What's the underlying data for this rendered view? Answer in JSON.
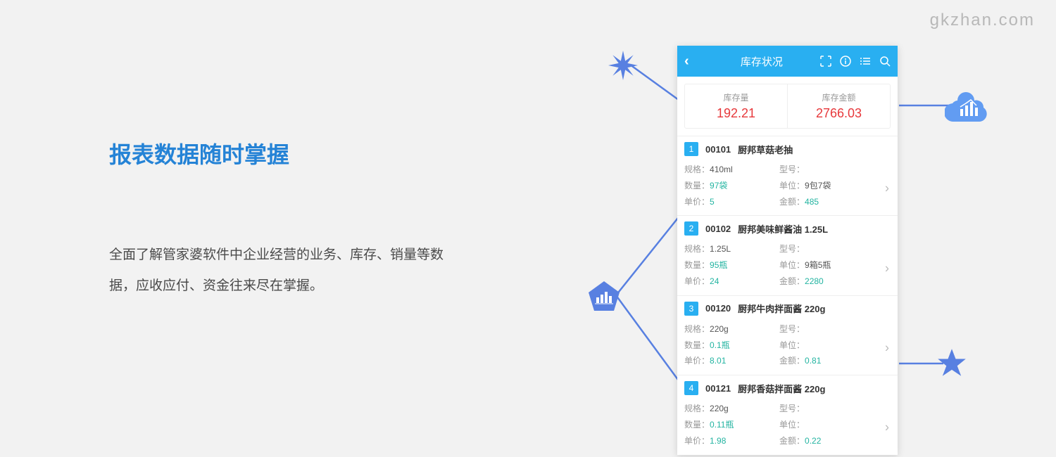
{
  "watermark": "gkzhan.com",
  "heading": "报表数据随时掌握",
  "description": "全面了解管家婆软件中企业经营的业务、库存、销量等数据，应收应付、资金往来尽在掌握。",
  "phone": {
    "title": "库存状况",
    "summary": {
      "qty_label": "库存量",
      "qty_value": "192.21",
      "amount_label": "库存金额",
      "amount_value": "2766.03"
    },
    "items": [
      {
        "num": "1",
        "code": "00101",
        "name": "厨邦草菇老抽",
        "spec_label": "规格：",
        "spec": "410ml",
        "model_label": "型号：",
        "model": "",
        "qty_label": "数量：",
        "qty": "97袋",
        "unit_label": "单位：",
        "unit": "9包7袋",
        "price_label": "单价：",
        "price": "5",
        "amount_label": "金额：",
        "amount": "485"
      },
      {
        "num": "2",
        "code": "00102",
        "name": "厨邦美味鲜酱油 1.25L",
        "spec_label": "规格：",
        "spec": "1.25L",
        "model_label": "型号：",
        "model": "",
        "qty_label": "数量：",
        "qty": "95瓶",
        "unit_label": "单位：",
        "unit": "9箱5瓶",
        "price_label": "单价：",
        "price": "24",
        "amount_label": "金额：",
        "amount": "2280"
      },
      {
        "num": "3",
        "code": "00120",
        "name": "厨邦牛肉拌面酱 220g",
        "spec_label": "规格：",
        "spec": "220g",
        "model_label": "型号：",
        "model": "",
        "qty_label": "数量：",
        "qty": "0.1瓶",
        "unit_label": "单位：",
        "unit": "",
        "price_label": "单价：",
        "price": "8.01",
        "amount_label": "金额：",
        "amount": "0.81"
      },
      {
        "num": "4",
        "code": "00121",
        "name": "厨邦香菇拌面酱 220g",
        "spec_label": "规格：",
        "spec": "220g",
        "model_label": "型号：",
        "model": "",
        "qty_label": "数量：",
        "qty": "0.11瓶",
        "unit_label": "单位：",
        "unit": "",
        "price_label": "单价：",
        "price": "1.98",
        "amount_label": "金额：",
        "amount": "0.22"
      }
    ]
  }
}
